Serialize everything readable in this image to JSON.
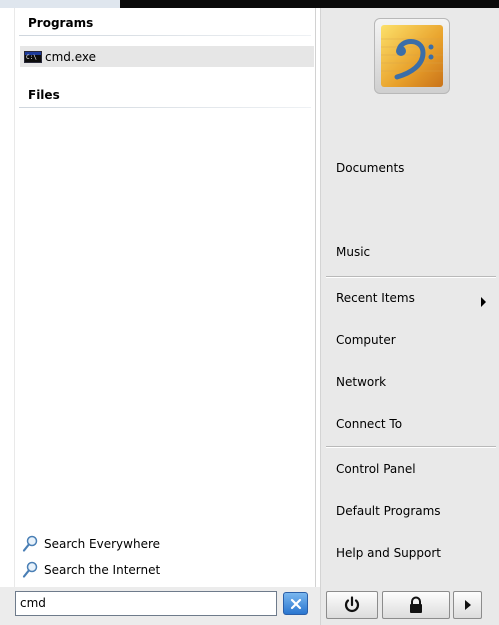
{
  "left": {
    "sections": [
      {
        "title": "Programs"
      },
      {
        "title": "Files"
      }
    ],
    "program_results": [
      {
        "label": "cmd.exe",
        "icon": "cmd-icon"
      }
    ],
    "search_links": [
      {
        "label": "Search Everywhere",
        "icon": "search-icon"
      },
      {
        "label": "Search the Internet",
        "icon": "search-icon"
      }
    ],
    "search": {
      "value": "cmd",
      "clear_icon": "close-icon"
    }
  },
  "right": {
    "user_picture": "bass-clef-icon",
    "items": [
      {
        "label": "Documents"
      },
      {
        "label": "Music"
      },
      {
        "label": "Recent Items",
        "submenu": true
      },
      {
        "label": "Computer"
      },
      {
        "label": "Network"
      },
      {
        "label": "Connect To"
      },
      {
        "label": "Control Panel"
      },
      {
        "label": "Default Programs"
      },
      {
        "label": "Help and Support"
      }
    ],
    "power_buttons": [
      {
        "icon": "power-icon"
      },
      {
        "icon": "lock-icon"
      },
      {
        "icon": "arrow-right-icon"
      }
    ]
  },
  "colors": {
    "highlight": "#e6e6e6",
    "right_pane": "#e9e9e9",
    "clear_button": "#2a76d0"
  }
}
